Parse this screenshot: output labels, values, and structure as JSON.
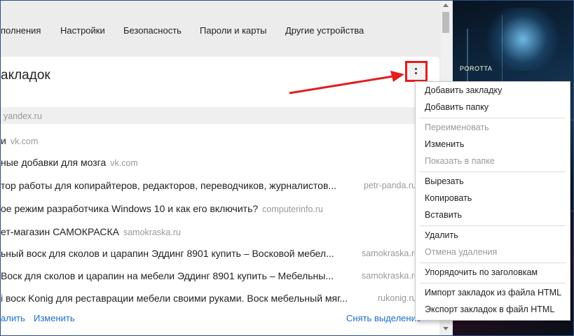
{
  "nav": {
    "items": [
      {
        "label": "полнения"
      },
      {
        "label": "Настройки"
      },
      {
        "label": "Безопасность"
      },
      {
        "label": "Пароли и карты"
      },
      {
        "label": "Другие устройства"
      }
    ]
  },
  "panel": {
    "title": "акладок"
  },
  "bookmarks": [
    {
      "title": "",
      "domain": "yandex.ru"
    },
    {
      "title": "и",
      "domain": "vk.com"
    },
    {
      "title": "ные добавки для мозга",
      "domain": "vk.com"
    },
    {
      "title": "тор работы для копирайтеров, редакторов, переводчиков, журналистов...",
      "domain": "petr-panda.ru"
    },
    {
      "title": "ое режим разработчика Windows 10 и как его включить?",
      "domain": "computerinfo.ru"
    },
    {
      "title": "ет-магазин САМОКРАСКА",
      "domain": "samokraska.ru"
    },
    {
      "title": "ьный воск для сколов и царапин Эддинг 8901 купить – Восковой мебел...",
      "domain": "samokraska.ru"
    },
    {
      "title": "Воск для сколов и царапин на мебели Эддинг 8901 купить – Мебельны...",
      "domain": "samokraska.ru"
    },
    {
      "title": "і воск Konig для реставрации мебели своими руками. Воск мебельный мяг...",
      "domain": "rukonig.ru"
    }
  ],
  "footer": {
    "delete_label": "алить",
    "edit_label": "Изменить",
    "deselect_label": "Снять выделение"
  },
  "background": {
    "sign_text": "POROTTA"
  },
  "context_menu": {
    "items": [
      {
        "label": "Добавить закладку",
        "enabled": true
      },
      {
        "label": "Добавить папку",
        "enabled": true
      },
      {
        "label": "Переименовать",
        "enabled": false
      },
      {
        "label": "Изменить",
        "enabled": true
      },
      {
        "label": "Показать в папке",
        "enabled": false
      },
      {
        "label": "Вырезать",
        "enabled": true
      },
      {
        "label": "Копировать",
        "enabled": true
      },
      {
        "label": "Вставить",
        "enabled": true
      },
      {
        "label": "Удалить",
        "enabled": true
      },
      {
        "label": "Отмена удаления",
        "enabled": false
      },
      {
        "label": "Упорядочить по заголовкам",
        "enabled": true
      },
      {
        "label": "Импорт закладок из файла HTML",
        "enabled": true
      },
      {
        "label": "Экспорт закладок в файл HTML",
        "enabled": true
      }
    ]
  },
  "colors": {
    "highlight_red": "#e21e1e",
    "link_blue": "#1a6ec7",
    "disabled_gray": "#9a9a9a"
  },
  "icons": [
    "more-vertical-icon",
    "annotation-arrow-icon",
    "scroll-up-icon",
    "scroll-down-icon"
  ]
}
